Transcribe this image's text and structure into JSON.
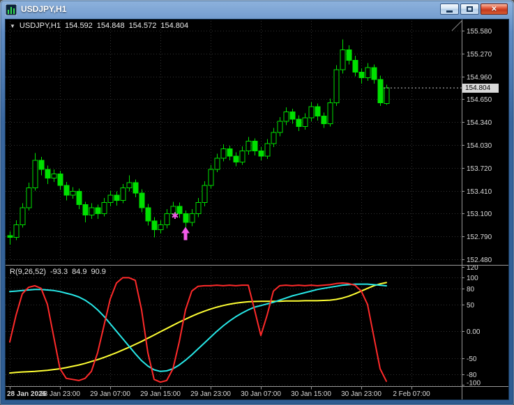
{
  "window": {
    "title": "USDJPY,H1",
    "close_glyph": "✕"
  },
  "colors": {
    "candle_up": "#00E000",
    "indicator_red": "#FF2A2A",
    "indicator_cyan": "#27E8E8",
    "indicator_yellow": "#FFFF33",
    "marker": "#F25AE8",
    "grid": "#343434",
    "axis_text": "#DCDCDC",
    "separator": "#9A9A9A",
    "titlebar_blue": "#39679F",
    "close_red": "#C23A1F",
    "price_box_bg": "#D9D9D9"
  },
  "info_line": {
    "marker": "▼",
    "symbol": "USDJPY,H1",
    "open": "154.592",
    "high": "154.848",
    "low": "154.572",
    "close": "154.804"
  },
  "price_axis": {
    "labels": [
      "155.580",
      "155.270",
      "154.960",
      "154.650",
      "154.340",
      "154.030",
      "153.720",
      "153.410",
      "153.100",
      "152.790",
      "152.480"
    ],
    "current_price": "154.804"
  },
  "time_axis": {
    "labels": [
      "28 Jan 2026",
      "28 Jan 23:00",
      "29 Jan 07:00",
      "29 Jan 15:00",
      "29 Jan 23:00",
      "30 Jan 07:00",
      "30 Jan 15:00",
      "30 Jan 23:00",
      "2 Feb 07:00"
    ]
  },
  "indicator": {
    "label": "R(9,26,52)",
    "values": [
      "-93.3",
      "84.9",
      "90.9"
    ],
    "axis_labels": [
      "120",
      "100",
      "80",
      "50",
      "0.00",
      "-50",
      "-80",
      "-100"
    ]
  },
  "chart_data": [
    {
      "type": "candlestick",
      "title": "USDJPY H1",
      "price_range": [
        152.48,
        155.58
      ],
      "price_gridlines": [
        155.58,
        155.27,
        154.96,
        154.65,
        154.34,
        154.03,
        153.72,
        153.41,
        153.1,
        152.79,
        152.48
      ],
      "last_price": 154.804,
      "candles": [
        [
          152.8,
          152.86,
          152.68,
          152.78
        ],
        [
          152.78,
          153.01,
          152.74,
          152.95
        ],
        [
          152.95,
          153.24,
          152.91,
          153.18
        ],
        [
          153.18,
          153.52,
          153.14,
          153.45
        ],
        [
          153.45,
          153.92,
          153.41,
          153.82
        ],
        [
          153.82,
          153.87,
          153.62,
          153.7
        ],
        [
          153.7,
          153.75,
          153.5,
          153.58
        ],
        [
          153.58,
          153.7,
          153.53,
          153.64
        ],
        [
          153.64,
          153.68,
          153.42,
          153.48
        ],
        [
          153.48,
          153.53,
          153.28,
          153.35
        ],
        [
          153.35,
          153.46,
          153.3,
          153.4
        ],
        [
          153.4,
          153.44,
          153.16,
          153.22
        ],
        [
          153.22,
          153.26,
          152.98,
          153.08
        ],
        [
          153.08,
          153.24,
          153.03,
          153.18
        ],
        [
          153.18,
          153.22,
          153.03,
          153.1
        ],
        [
          153.1,
          153.31,
          153.06,
          153.25
        ],
        [
          153.25,
          153.41,
          153.2,
          153.35
        ],
        [
          153.35,
          153.4,
          153.21,
          153.28
        ],
        [
          153.28,
          153.5,
          153.24,
          153.45
        ],
        [
          153.45,
          153.62,
          153.4,
          153.52
        ],
        [
          153.52,
          153.56,
          153.32,
          153.38
        ],
        [
          153.38,
          153.43,
          153.12,
          153.18
        ],
        [
          153.18,
          153.23,
          152.94,
          153.0
        ],
        [
          153.0,
          153.05,
          152.78,
          152.88
        ],
        [
          152.88,
          153.01,
          152.83,
          152.95
        ],
        [
          152.95,
          153.16,
          152.9,
          153.1
        ],
        [
          153.1,
          153.26,
          153.05,
          153.2
        ],
        [
          153.2,
          153.25,
          153.04,
          153.1
        ],
        [
          153.1,
          153.14,
          152.88,
          152.98
        ],
        [
          152.98,
          153.16,
          152.93,
          153.1
        ],
        [
          153.1,
          153.31,
          153.05,
          153.25
        ],
        [
          153.25,
          153.54,
          153.2,
          153.48
        ],
        [
          153.48,
          153.76,
          153.44,
          153.7
        ],
        [
          153.7,
          153.91,
          153.66,
          153.85
        ],
        [
          153.85,
          154.04,
          153.81,
          153.98
        ],
        [
          153.98,
          154.02,
          153.82,
          153.88
        ],
        [
          153.88,
          153.93,
          153.74,
          153.8
        ],
        [
          153.8,
          154.01,
          153.76,
          153.95
        ],
        [
          153.95,
          154.14,
          153.9,
          154.08
        ],
        [
          154.08,
          154.12,
          153.89,
          153.95
        ],
        [
          153.95,
          154.0,
          153.82,
          153.88
        ],
        [
          153.88,
          154.11,
          153.84,
          154.05
        ],
        [
          154.05,
          154.26,
          154.0,
          154.2
        ],
        [
          154.2,
          154.41,
          154.15,
          154.35
        ],
        [
          154.35,
          154.54,
          154.3,
          154.48
        ],
        [
          154.48,
          154.52,
          154.32,
          154.38
        ],
        [
          154.38,
          154.43,
          154.22,
          154.28
        ],
        [
          154.28,
          154.46,
          154.24,
          154.4
        ],
        [
          154.4,
          154.61,
          154.35,
          154.55
        ],
        [
          154.55,
          154.59,
          154.36,
          154.42
        ],
        [
          154.42,
          154.47,
          154.26,
          154.32
        ],
        [
          154.32,
          154.66,
          154.28,
          154.6
        ],
        [
          154.6,
          155.11,
          154.56,
          155.05
        ],
        [
          155.05,
          155.46,
          155.0,
          155.32
        ],
        [
          155.32,
          155.38,
          155.12,
          155.18
        ],
        [
          155.18,
          155.24,
          154.96,
          155.02
        ],
        [
          155.02,
          155.07,
          154.86,
          154.94
        ],
        [
          154.94,
          155.14,
          154.9,
          155.08
        ],
        [
          155.08,
          155.12,
          154.86,
          154.92
        ],
        [
          154.92,
          154.97,
          154.56,
          154.6
        ],
        [
          154.592,
          154.848,
          154.572,
          154.804
        ]
      ],
      "markers": [
        {
          "shape": "asterisk",
          "index": 27,
          "price": 153.03
        },
        {
          "shape": "arrow-up",
          "index": 28,
          "price": 152.92
        }
      ]
    },
    {
      "type": "line",
      "title": "R(9,26,52)",
      "y_range": [
        -100,
        120
      ],
      "levels": [
        100,
        80,
        50,
        0,
        -50,
        -80,
        -100
      ],
      "current_values": [
        -93.3,
        84.9,
        90.9
      ],
      "series": [
        {
          "name": "wpr-fast",
          "color": "#FF2A2A",
          "values": [
            -20,
            30,
            70,
            82,
            85,
            80,
            50,
            -10,
            -70,
            -88,
            -90,
            -92,
            -88,
            -75,
            -40,
            10,
            60,
            90,
            100,
            100,
            95,
            40,
            -40,
            -90,
            -95,
            -92,
            -70,
            -20,
            40,
            75,
            84,
            85,
            85,
            86,
            85,
            86,
            85,
            86,
            86,
            40,
            -8,
            30,
            75,
            85,
            86,
            85,
            86,
            85,
            86,
            85,
            86,
            87,
            89,
            90,
            89,
            86,
            75,
            50,
            -10,
            -70,
            -93.3
          ]
        },
        {
          "name": "wpr-mid",
          "color": "#27E8E8",
          "values": [
            74,
            75,
            76,
            77,
            78,
            78,
            77,
            76,
            74,
            71,
            68,
            64,
            58,
            50,
            40,
            28,
            14,
            0,
            -14,
            -28,
            -42,
            -55,
            -65,
            -72,
            -75,
            -74,
            -70,
            -63,
            -54,
            -44,
            -33,
            -22,
            -11,
            0,
            10,
            19,
            27,
            34,
            40,
            45,
            48,
            51,
            54,
            58,
            62,
            66,
            69,
            72,
            75,
            78,
            80,
            82,
            84,
            86,
            87,
            88,
            88,
            88,
            87,
            86,
            84.9
          ]
        },
        {
          "name": "wpr-slow",
          "color": "#FFFF33",
          "values": [
            -78,
            -77,
            -76,
            -75.5,
            -75,
            -74,
            -73,
            -71.5,
            -70,
            -68,
            -65.5,
            -63,
            -60,
            -56.5,
            -53,
            -49,
            -44.5,
            -40,
            -35,
            -30,
            -24.5,
            -19,
            -13,
            -7,
            -1,
            5,
            11,
            17,
            22.5,
            28,
            33,
            37.5,
            41.5,
            45,
            48,
            50.5,
            52.5,
            54,
            55,
            55.5,
            56,
            56,
            56,
            56,
            56.5,
            56.5,
            56.5,
            57,
            57,
            57,
            57.5,
            58,
            59.5,
            62,
            65.5,
            70,
            75,
            80,
            85,
            88.5,
            90.9
          ]
        }
      ]
    }
  ]
}
